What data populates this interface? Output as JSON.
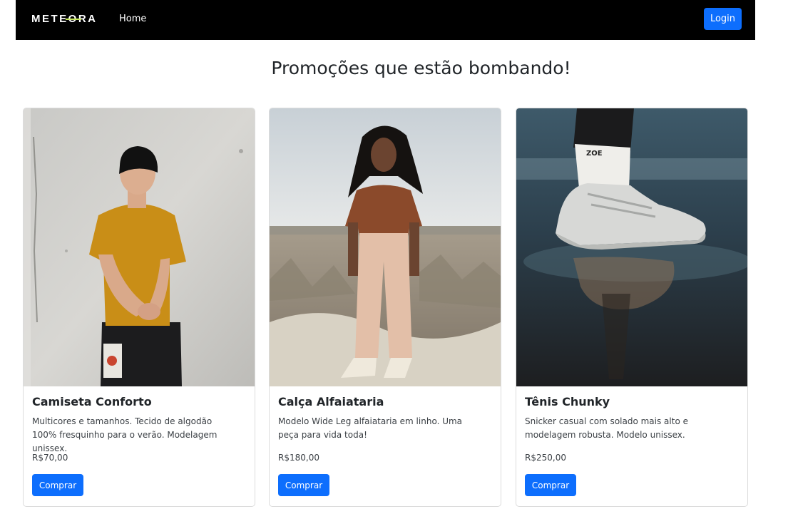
{
  "navbar": {
    "brand": "METEORA",
    "home_label": "Home",
    "login_label": "Login"
  },
  "page_title": "Promoções que estão bombando!",
  "products": [
    {
      "title": "Camiseta Conforto",
      "description": "Multicores e tamanhos. Tecido de algodão 100% fresquinho para o verão. Modelagem unissex.",
      "price": "R$70,00",
      "button_label": "Comprar"
    },
    {
      "title": "Calça Alfaiataria",
      "description": "Modelo Wide Leg alfaiataria em linho. Uma peça para vida toda!",
      "price": "R$180,00",
      "button_label": "Comprar"
    },
    {
      "title": "Tênis Chunky",
      "description": "Snicker casual com solado mais alto e modelagem robusta. Modelo unissex.",
      "price": "R$250,00",
      "button_label": "Comprar"
    }
  ],
  "sock_text": "ZOE",
  "colors": {
    "navbar_bg": "#000000",
    "primary": "#0d6efd",
    "brand_accent": "#c6e75a"
  }
}
